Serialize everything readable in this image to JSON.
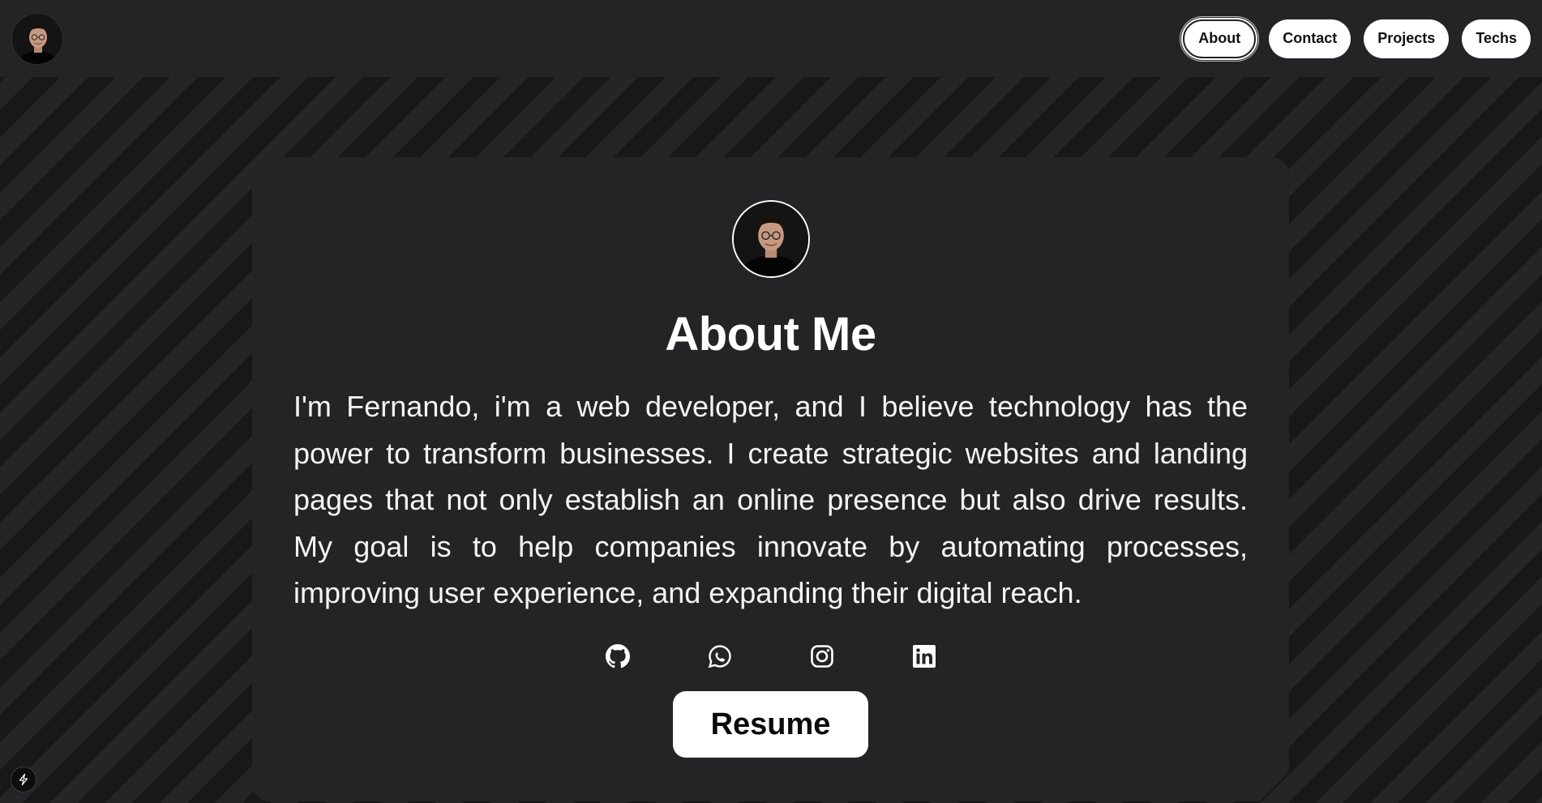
{
  "header": {
    "avatar_icon": "profile-photo",
    "nav": [
      {
        "label": "About",
        "active": true
      },
      {
        "label": "Contact",
        "active": false
      },
      {
        "label": "Projects",
        "active": false
      },
      {
        "label": "Techs",
        "active": false
      }
    ]
  },
  "about": {
    "title": "About Me",
    "bio": "I'm Fernando, i'm a web developer, and I believe technology has the power to transform businesses. I create strategic websites and landing pages that not only establish an online presence but also drive results. My goal is to help companies innovate by automating processes, improving user experience, and expanding their digital reach.",
    "socials": [
      {
        "icon": "github-icon"
      },
      {
        "icon": "whatsapp-icon"
      },
      {
        "icon": "instagram-icon"
      },
      {
        "icon": "linkedin-icon"
      }
    ],
    "resume_label": "Resume"
  },
  "colors": {
    "background": "#1e1e20",
    "surface": "#242426",
    "text": "#ffffff",
    "button_bg": "#ffffff",
    "button_text": "#111111"
  },
  "badge_icon": "lightning-icon"
}
